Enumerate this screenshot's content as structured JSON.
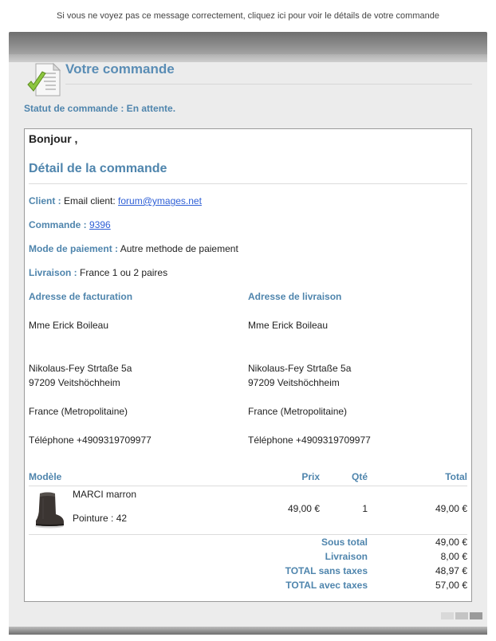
{
  "top_notice": "Si vous ne voyez pas ce message correctement, cliquez ici pour voir le détails de votre commande",
  "header": {
    "title": "Votre commande",
    "status": "Statut de commande : En attente."
  },
  "greeting": "Bonjour ,",
  "detail": {
    "title": "Détail de la commande",
    "client_label": "Client :",
    "client_text": "Email client:",
    "client_email": "forum@ymages.net",
    "order_label": "Commande :",
    "order_number": "9396",
    "payment_label": "Mode de paiement :",
    "payment_value": "Autre methode de paiement",
    "shipping_label": "Livraison :",
    "shipping_value": "France 1 ou 2 paires"
  },
  "billing": {
    "title": "Adresse de facturation",
    "name": "Mme Erick Boileau",
    "street": "Nikolaus-Fey Strtaße 5a",
    "city": "97209 Veitshöchheim",
    "country": "France (Metropolitaine)",
    "phone": "Téléphone +4909319709977"
  },
  "delivery": {
    "title": "Adresse de livraison",
    "name": "Mme Erick Boileau",
    "street": "Nikolaus-Fey Strtaße 5a",
    "city": "97209 Veitshöchheim",
    "country": "France (Metropolitaine)",
    "phone": "Téléphone +4909319709977"
  },
  "table": {
    "headers": {
      "model": "Modèle",
      "price": "Prix",
      "qty": "Qté",
      "total": "Total"
    },
    "items": [
      {
        "name": "MARCI marron",
        "size": "Pointure : 42",
        "price": "49,00 €",
        "qty": "1",
        "total": "49,00 €",
        "icon": "boot-icon"
      }
    ]
  },
  "totals": [
    {
      "label": "Sous total",
      "value": "49,00 €"
    },
    {
      "label": "Livraison",
      "value": "8,00 €"
    },
    {
      "label": "TOTAL sans taxes",
      "value": "48,97 €"
    },
    {
      "label": "TOTAL avec taxes",
      "value": "57,00 €"
    }
  ],
  "colors": {
    "accent": "#4f85ad",
    "link": "#2e5fd6",
    "frame": "#ececec"
  }
}
